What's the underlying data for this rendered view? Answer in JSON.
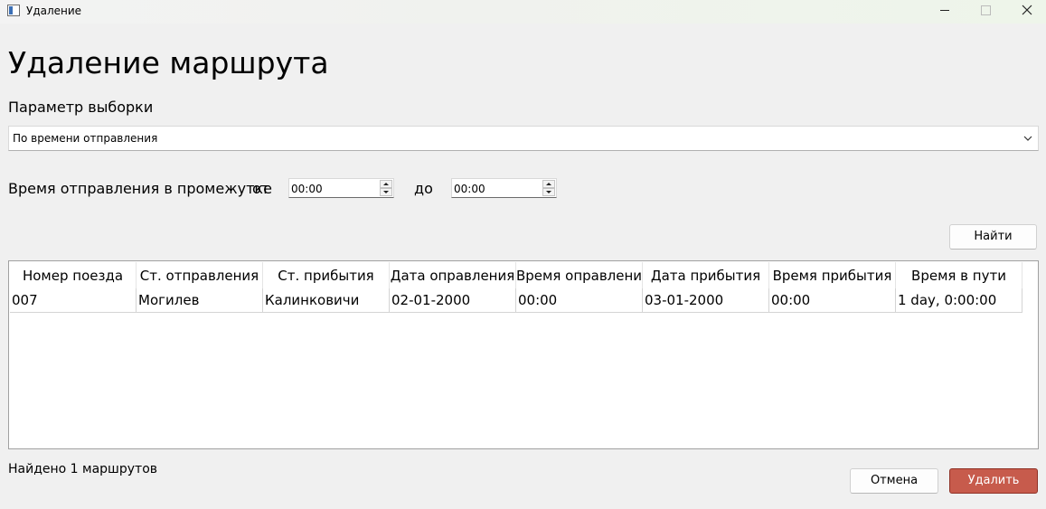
{
  "window": {
    "title": "Удаление"
  },
  "page": {
    "title": "Удаление маршрута"
  },
  "filter": {
    "label": "Параметр выборки",
    "selected": "По времени отправления"
  },
  "time_range": {
    "label": "Время отправления в промежутке",
    "from_label": "от",
    "from_value": "00:00",
    "to_label": "до",
    "to_value": "00:00"
  },
  "buttons": {
    "find": "Найти",
    "cancel": "Отмена",
    "delete": "Удалить"
  },
  "table": {
    "columns": [
      "Номер поезда",
      "Ст. отправления",
      "Ст. прибытия",
      "Дата оправления",
      "Время оправления",
      "Дата прибытия",
      "Время прибытия",
      "Время в пути"
    ],
    "rows": [
      [
        "007",
        "Могилев",
        "Калинковичи",
        "02-01-2000",
        "00:00",
        "03-01-2000",
        "00:00",
        "1 day, 0:00:00"
      ]
    ]
  },
  "status": "Найдено 1 маршрутов",
  "colors": {
    "delete_button": "#c75b4c",
    "window_background": "#f0f0f0"
  }
}
